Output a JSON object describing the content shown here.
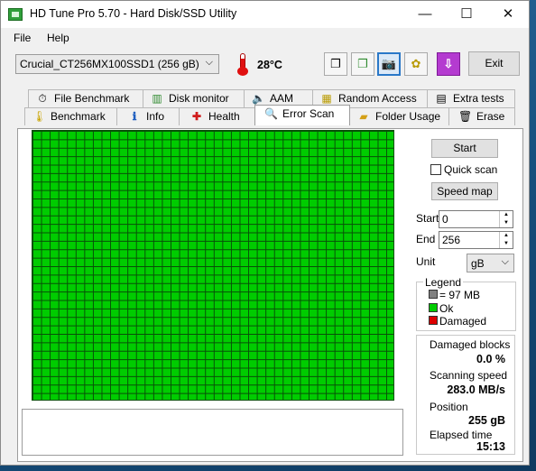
{
  "window": {
    "title": "HD Tune Pro 5.70 - Hard Disk/SSD Utility",
    "minimize": "—",
    "maximize": "☐",
    "close": "✕"
  },
  "menu": {
    "file": "File",
    "help": "Help"
  },
  "toolbar": {
    "drive": "Crucial_CT256MX100SSD1 (256 gB)",
    "temperature": "28°C",
    "exit_label": "Exit",
    "icons": [
      "copy-text-icon",
      "copy-info-icon",
      "screenshot-icon",
      "options-icon",
      "save-icon"
    ]
  },
  "tabs": {
    "row1": [
      "File Benchmark",
      "Disk monitor",
      "AAM",
      "Random Access",
      "Extra tests"
    ],
    "row2": [
      "Benchmark",
      "Info",
      "Health",
      "Error Scan",
      "Folder Usage",
      "Erase"
    ],
    "selected": "Error Scan"
  },
  "controls": {
    "start_button": "Start",
    "quick_scan": "Quick scan",
    "quick_scan_checked": false,
    "speed_map_button": "Speed map",
    "start_label": "Start",
    "start_value": "0",
    "end_label": "End",
    "end_value": "256",
    "unit_label": "Unit",
    "unit_value": "gB"
  },
  "legend": {
    "title": "Legend",
    "block": "= 97 MB",
    "ok": "Ok",
    "damaged": "Damaged"
  },
  "stats": {
    "damaged_blocks_label": "Damaged blocks",
    "damaged_blocks_value": "0.0 %",
    "scanning_speed_label": "Scanning speed",
    "scanning_speed_value": "283.0 MB/s",
    "position_label": "Position",
    "position_value": "255 gB",
    "elapsed_label": "Elapsed time",
    "elapsed_value": "15:13"
  },
  "colors": {
    "ok": "#00cc00",
    "damaged": "#dd0000",
    "block": "#808080",
    "grid_line": "#084f08"
  }
}
